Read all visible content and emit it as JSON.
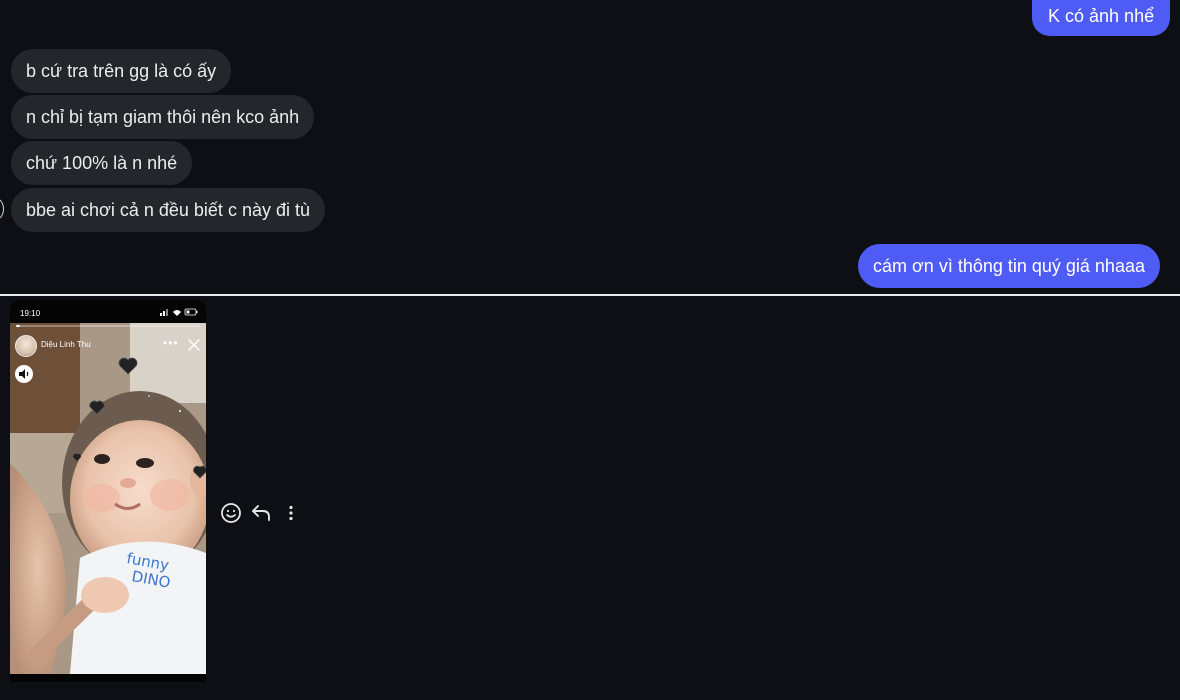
{
  "messages": [
    {
      "id": "m1",
      "direction": "outgoing",
      "text": "K có ảnh nhể"
    },
    {
      "id": "m2",
      "direction": "incoming",
      "text": "b cứ tra trên gg là có ấy"
    },
    {
      "id": "m3",
      "direction": "incoming",
      "text": "n chỉ bị tạm giam thôi nên kco ảnh"
    },
    {
      "id": "m4",
      "direction": "incoming",
      "text": "chứ 100% là n nhé"
    },
    {
      "id": "m5",
      "direction": "incoming",
      "text": "bbe ai chơi cả n đều biết c này đi tù"
    },
    {
      "id": "m6",
      "direction": "outgoing",
      "text": "cám ơn vì thông tin quý giá nhaaa"
    }
  ],
  "colors": {
    "background": "#0d0f14",
    "outgoing_bubble": "#4e5cf5",
    "incoming_bubble": "#24262c",
    "divider": "#e9e9e9"
  },
  "story": {
    "status_time": "19:10",
    "username": "Diệu Linh Thu",
    "progress": 0.02,
    "icons": {
      "more": "more-horizontal-icon",
      "close": "close-icon",
      "sound": "speaker-icon"
    },
    "photo_sticker_text": "funny DINO"
  },
  "actions": [
    {
      "id": "react",
      "icon": "smiley-icon"
    },
    {
      "id": "reply",
      "icon": "reply-arrow-icon"
    },
    {
      "id": "more",
      "icon": "more-vertical-icon"
    }
  ]
}
